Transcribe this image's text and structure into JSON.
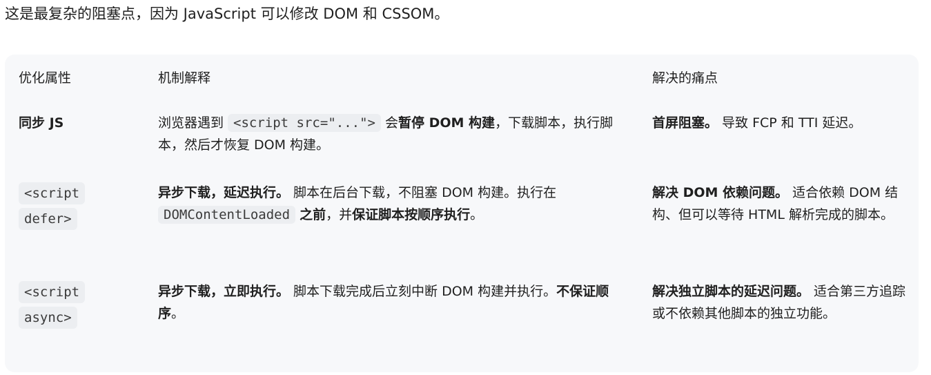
{
  "intro": {
    "text": "这是最复杂的阻塞点，因为 JavaScript 可以修改 DOM 和 CSSOM。"
  },
  "table": {
    "headers": [
      "优化属性",
      "机制解释",
      "解决的痛点"
    ],
    "rows": [
      {
        "attr": "同步 JS",
        "mechanism": [
          {
            "t": "text",
            "v": "浏览器遇到 "
          },
          {
            "t": "code",
            "v": "<script src=\"...\">"
          },
          {
            "t": "text",
            "v": " 会"
          },
          {
            "t": "bold",
            "v": "暂停 DOM 构建"
          },
          {
            "t": "text",
            "v": "，下载脚本，执行脚本，然后才恢复 DOM 构建。"
          }
        ],
        "pain": [
          {
            "t": "bold",
            "v": "首屏阻塞。"
          },
          {
            "t": "text",
            "v": " 导致 FCP 和 TTI 延迟。"
          }
        ]
      },
      {
        "attr_code": [
          "<script",
          "defer>"
        ],
        "mechanism": [
          {
            "t": "bold",
            "v": "异步下载，延迟执行。"
          },
          {
            "t": "text",
            "v": " 脚本在后台下载，不阻塞 DOM 构建。执行在 "
          },
          {
            "t": "code",
            "v": "DOMContentLoaded"
          },
          {
            "t": "text",
            "v": " "
          },
          {
            "t": "bold",
            "v": "之前"
          },
          {
            "t": "text",
            "v": "，并"
          },
          {
            "t": "bold",
            "v": "保证脚本按顺序执行"
          },
          {
            "t": "text",
            "v": "。"
          }
        ],
        "pain": [
          {
            "t": "bold",
            "v": "解决 DOM 依赖问题。"
          },
          {
            "t": "text",
            "v": " 适合依赖 DOM 结构、但可以等待 HTML 解析完成的脚本。"
          }
        ]
      },
      {
        "attr_code": [
          "<script",
          "async>"
        ],
        "mechanism": [
          {
            "t": "bold",
            "v": "异步下载，立即执行。"
          },
          {
            "t": "text",
            "v": " 脚本下载完成后立刻中断 DOM 构建并执行。"
          },
          {
            "t": "bold",
            "v": "不保证顺序"
          },
          {
            "t": "text",
            "v": "。"
          }
        ],
        "pain": [
          {
            "t": "bold",
            "v": "解决独立脚本的延迟问题。"
          },
          {
            "t": "text",
            "v": " 适合第三方追踪或不依赖其他脚本的独立功能。"
          }
        ]
      }
    ]
  }
}
